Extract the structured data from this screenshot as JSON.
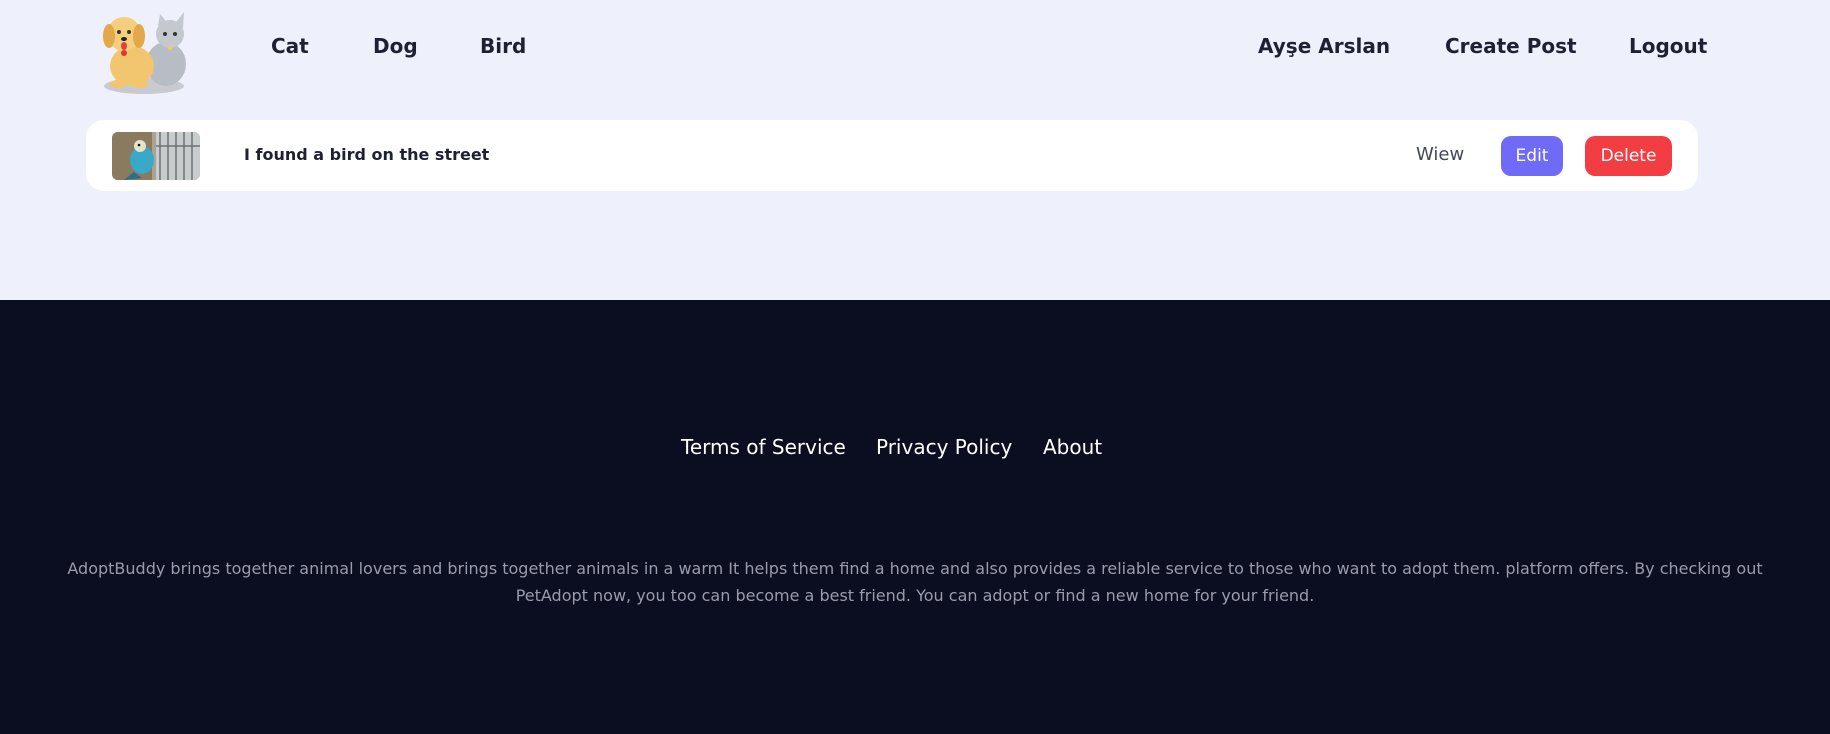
{
  "header": {
    "nav": {
      "cat": "Cat",
      "dog": "Dog",
      "bird": "Bird"
    },
    "user": {
      "name": "Ayşe Arslan",
      "create_post": "Create Post",
      "logout": "Logout"
    }
  },
  "posts": [
    {
      "title": "I found a bird on the street",
      "view_label": "Wiew",
      "edit_label": "Edit",
      "delete_label": "Delete"
    }
  ],
  "footer": {
    "links": {
      "terms": "Terms of Service",
      "privacy": "Privacy Policy",
      "about": "About"
    },
    "description": "AdoptBuddy brings together animal lovers and brings together animals in a warm It helps them find a home and also provides a reliable service to those who want to adopt them. platform offers. By checking out PetAdopt now, you too can become a best friend. You can adopt or find a new home for your friend."
  },
  "colors": {
    "page_bg": "#eef1fb",
    "footer_bg": "#0b0d21",
    "edit_button": "#6f6bf6",
    "delete_button": "#f23d43",
    "text_dark": "#1f2033"
  }
}
